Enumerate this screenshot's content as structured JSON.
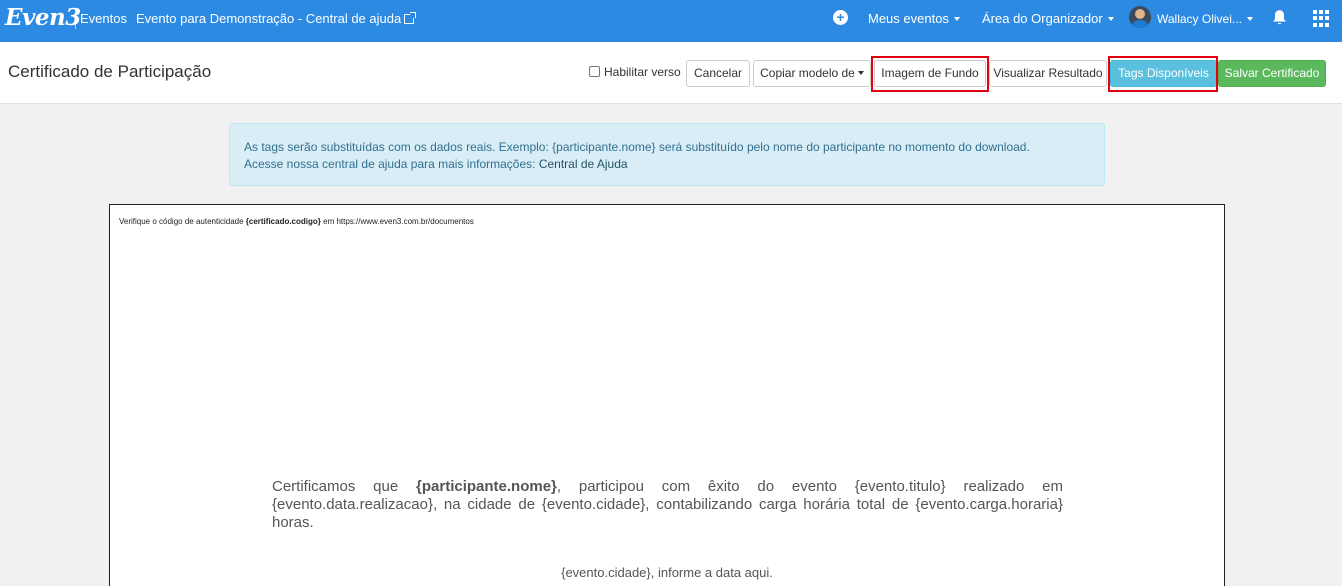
{
  "navbar": {
    "logo": "Even3",
    "events_label": "Eventos",
    "event_link": "Evento para Demonstração - Central de ajuda",
    "my_events": "Meus eventos",
    "organizer_area": "Área do Organizador",
    "user_name": "Wallacy Olivei...",
    "brand_color": "#2d8ae3",
    "icons": [
      "plus-icon",
      "bell-icon",
      "apps-grid-icon",
      "external-link-icon"
    ]
  },
  "header": {
    "title": "Certificado de Participação",
    "enable_back_label": "Habilitar verso",
    "enable_back_checked": false,
    "buttons": {
      "cancel": "Cancelar",
      "copy_template": "Copiar modelo de",
      "background_image": "Imagem de Fundo",
      "preview": "Visualizar Resultado",
      "available_tags": "Tags Disponíveis",
      "save": "Salvar Certificado"
    }
  },
  "alert": {
    "line1": "As tags serão substituídas com os dados reais. Exemplo: {participante.nome} será substituído pelo nome do participante no momento do download.",
    "line2_prefix": "Acesse nossa central de ajuda para mais informações: ",
    "line2_link": "Central de Ajuda"
  },
  "certificate": {
    "verify_prefix": "Verifique o código de autenticidade ",
    "verify_tag": "{certificado.codigo}",
    "verify_suffix": " em https://www.even3.com.br/documentos",
    "body_prefix": "Certificamos que ",
    "body_name_tag": "{participante.nome}",
    "body_suffix": ", participou com êxito do evento {evento.titulo} realizado em {evento.data.realizacao}, na cidade de {evento.cidade}, contabilizando carga horária total de {evento.carga.horaria} horas.",
    "date_line": "{evento.cidade}, informe a data aqui."
  }
}
